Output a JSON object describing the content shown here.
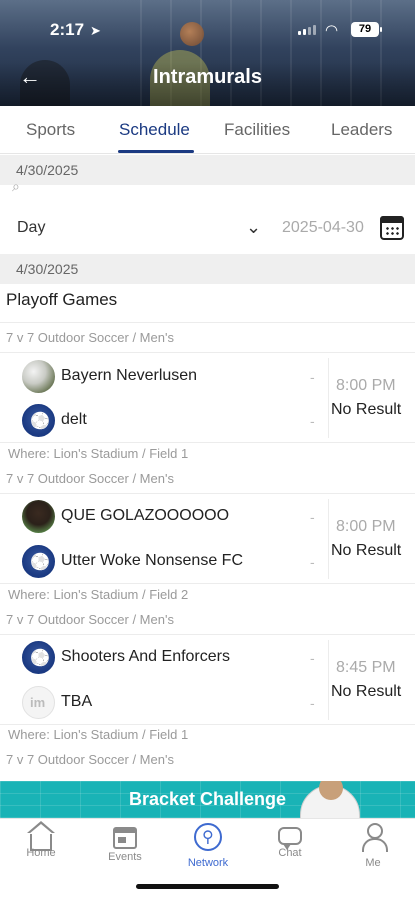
{
  "status_bar": {
    "time": "2:17",
    "battery": "79"
  },
  "header": {
    "title": "Intramurals"
  },
  "tabs": [
    {
      "label": "Sports"
    },
    {
      "label": "Schedule"
    },
    {
      "label": "Facilities"
    },
    {
      "label": "Leaders"
    }
  ],
  "top_date": "4/30/2025",
  "filter": {
    "mode": "Day",
    "date": "2025-04-30"
  },
  "list_date": "4/30/2025",
  "section_title": "Playoff Games",
  "games": [
    {
      "category": "7 v 7 Outdoor Soccer / Men's",
      "home": "Bayern Neverlusen",
      "away": "delt",
      "home_score": "-",
      "away_score": "-",
      "time": "8:00 PM",
      "result": "No Result",
      "where": "Where: Lion's Stadium / Field 1"
    },
    {
      "category": "7 v 7 Outdoor Soccer / Men's",
      "home": "QUE GOLAZOOOOOO",
      "away": "Utter Woke Nonsense FC",
      "home_score": "-",
      "away_score": "-",
      "time": "8:00 PM",
      "result": "No Result",
      "where": "Where: Lion's Stadium / Field 2"
    },
    {
      "category": "7 v 7 Outdoor Soccer / Men's",
      "home": "Shooters And Enforcers",
      "away": "TBA",
      "home_score": "-",
      "away_score": "-",
      "time": "8:45 PM",
      "result": "No Result",
      "where": "Where: Lion's Stadium / Field 1"
    }
  ],
  "next_category": "7 v 7 Outdoor Soccer / Men's",
  "banner": {
    "label": "Bracket Challenge"
  },
  "bottom_nav": [
    {
      "label": "Home"
    },
    {
      "label": "Events"
    },
    {
      "label": "Network"
    },
    {
      "label": "Chat"
    },
    {
      "label": "Me"
    }
  ],
  "colors": {
    "primary": "#1b3a82",
    "accent": "#3e6ad0",
    "banner": "#19b3b6"
  }
}
